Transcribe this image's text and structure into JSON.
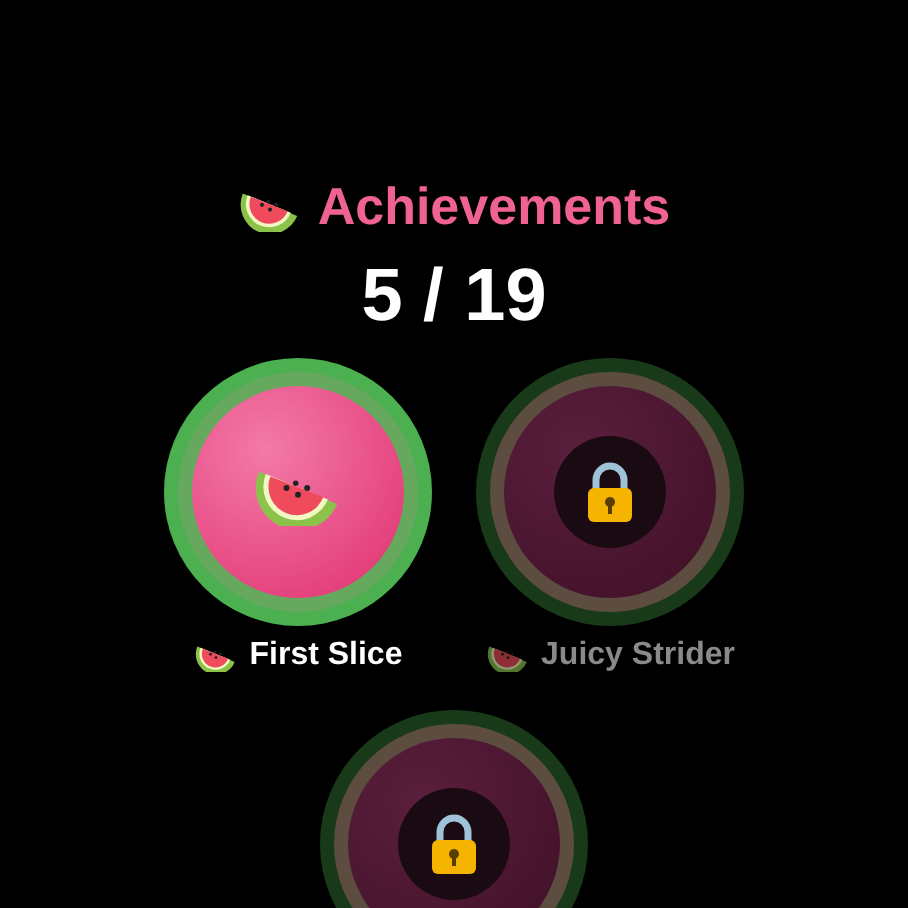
{
  "header": {
    "title": "Achievements"
  },
  "progress": "5 / 19",
  "achievements": [
    {
      "name": "First Slice",
      "unlocked": true
    },
    {
      "name": "Juicy Strider",
      "unlocked": false
    },
    {
      "unlocked": false
    }
  ]
}
